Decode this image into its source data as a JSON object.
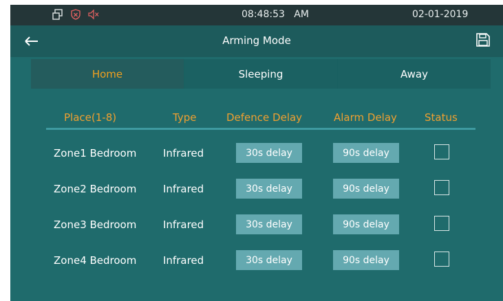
{
  "status_bar": {
    "time": "08:48:53",
    "ampm": "AM",
    "date": "02-01-2019",
    "icons": [
      "window-icon",
      "shield-icon",
      "mute-icon"
    ]
  },
  "title_bar": {
    "title": "Arming Mode",
    "back_icon": "back-arrow-icon",
    "save_icon": "save-icon"
  },
  "tabs": [
    {
      "label": "Home",
      "active": true
    },
    {
      "label": "Sleeping",
      "active": false
    },
    {
      "label": "Away",
      "active": false
    }
  ],
  "table": {
    "headers": [
      "Place(1-8)",
      "Type",
      "Defence Delay",
      "Alarm Delay",
      "Status"
    ],
    "rows": [
      {
        "place": "Zone1 Bedroom",
        "type": "Infrared",
        "defence_delay": "30s delay",
        "alarm_delay": "90s delay",
        "status": false
      },
      {
        "place": "Zone2 Bedroom",
        "type": "Infrared",
        "defence_delay": "30s delay",
        "alarm_delay": "90s delay",
        "status": false
      },
      {
        "place": "Zone3 Bedroom",
        "type": "Infrared",
        "defence_delay": "30s delay",
        "alarm_delay": "90s delay",
        "status": false
      },
      {
        "place": "Zone4 Bedroom",
        "type": "Infrared",
        "defence_delay": "30s delay",
        "alarm_delay": "90s delay",
        "status": false
      }
    ]
  },
  "colors": {
    "background": "#1f6b6c",
    "status_bar": "#243638",
    "accent": "#f0a020",
    "delay_button": "#64a9b0"
  }
}
